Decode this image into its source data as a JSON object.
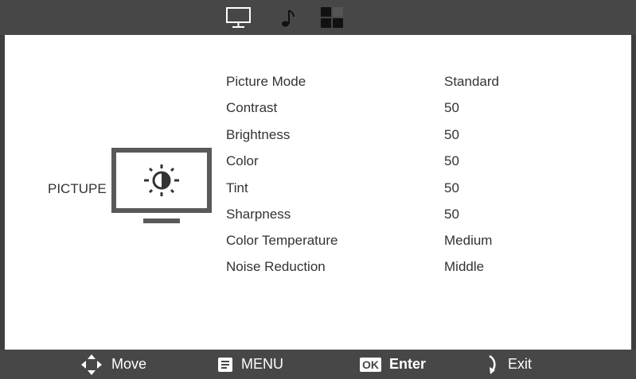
{
  "top_tabs": [
    {
      "icon": "monitor-icon"
    },
    {
      "icon": "music-note-icon"
    },
    {
      "icon": "grid-icon"
    }
  ],
  "section": {
    "title": "PICTUPE",
    "icon": "picture-brightness-icon"
  },
  "menu": [
    {
      "label": "Picture Mode",
      "value": "Standard"
    },
    {
      "label": "Contrast",
      "value": "50"
    },
    {
      "label": "Brightness",
      "value": "50"
    },
    {
      "label": "Color",
      "value": "50"
    },
    {
      "label": "Tint",
      "value": "50"
    },
    {
      "label": "Sharpness",
      "value": "50"
    },
    {
      "label": "Color Temperature",
      "value": "Medium"
    },
    {
      "label": "Noise Reduction",
      "value": "Middle"
    }
  ],
  "footer": {
    "move": {
      "label": "Move",
      "icon": "move-arrows-icon"
    },
    "menu": {
      "label": "MENU",
      "icon": "menu-icon"
    },
    "enter": {
      "label": "Enter",
      "badge": "OK",
      "icon": "ok-icon"
    },
    "exit": {
      "label": "Exit",
      "icon": "return-icon"
    }
  },
  "colors": {
    "bar": "#474747",
    "text": "#333333",
    "icon": "#595959"
  }
}
